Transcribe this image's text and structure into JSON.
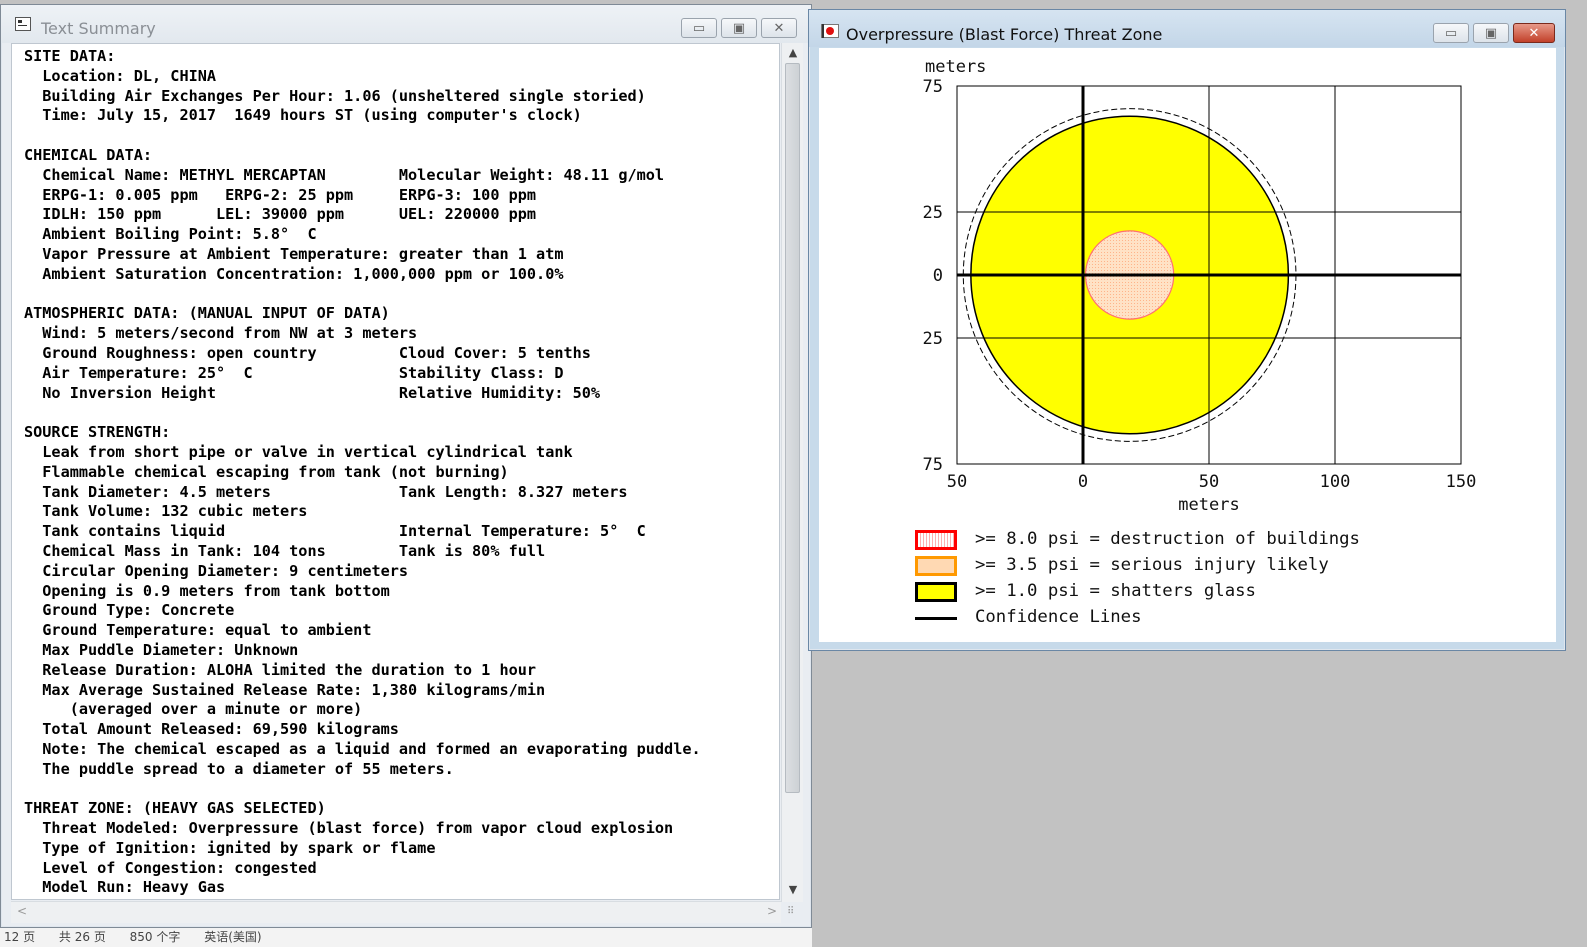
{
  "text_window": {
    "title": "Text Summary",
    "minimize_glyph": "▭",
    "maximize_glyph": "▣",
    "close_glyph": "✕",
    "scroll_up_glyph": "▲",
    "scroll_down_glyph": "▼",
    "scroll_left_glyph": "<",
    "scroll_right_glyph": ">",
    "resize_grip_glyph": "⠿",
    "lines": [
      "SITE DATA:",
      "  Location: DL, CHINA",
      "  Building Air Exchanges Per Hour: 1.06 (unsheltered single storied)",
      "  Time: July 15, 2017  1649 hours ST (using computer's clock)",
      "",
      "CHEMICAL DATA:",
      "  Chemical Name: METHYL MERCAPTAN        Molecular Weight: 48.11 g/mol",
      "  ERPG-1: 0.005 ppm   ERPG-2: 25 ppm     ERPG-3: 100 ppm",
      "  IDLH: 150 ppm      LEL: 39000 ppm      UEL: 220000 ppm",
      "  Ambient Boiling Point: 5.8°  C",
      "  Vapor Pressure at Ambient Temperature: greater than 1 atm",
      "  Ambient Saturation Concentration: 1,000,000 ppm or 100.0%",
      "",
      "ATMOSPHERIC DATA: (MANUAL INPUT OF DATA)",
      "  Wind: 5 meters/second from NW at 3 meters",
      "  Ground Roughness: open country         Cloud Cover: 5 tenths",
      "  Air Temperature: 25°  C                Stability Class: D",
      "  No Inversion Height                    Relative Humidity: 50%",
      "",
      "SOURCE STRENGTH:",
      "  Leak from short pipe or valve in vertical cylindrical tank",
      "  Flammable chemical escaping from tank (not burning)",
      "  Tank Diameter: 4.5 meters              Tank Length: 8.327 meters",
      "  Tank Volume: 132 cubic meters",
      "  Tank contains liquid                   Internal Temperature: 5°  C",
      "  Chemical Mass in Tank: 104 tons        Tank is 80% full",
      "  Circular Opening Diameter: 9 centimeters",
      "  Opening is 0.9 meters from tank bottom",
      "  Ground Type: Concrete",
      "  Ground Temperature: equal to ambient",
      "  Max Puddle Diameter: Unknown",
      "  Release Duration: ALOHA limited the duration to 1 hour",
      "  Max Average Sustained Release Rate: 1,380 kilograms/min",
      "     (averaged over a minute or more)",
      "  Total Amount Released: 69,590 kilograms",
      "  Note: The chemical escaped as a liquid and formed an evaporating puddle.",
      "  The puddle spread to a diameter of 55 meters.",
      "",
      "THREAT ZONE: (HEAVY GAS SELECTED)",
      "  Threat Modeled: Overpressure (blast force) from vapor cloud explosion",
      "  Type of Ignition: ignited by spark or flame",
      "  Level of Congestion: congested",
      "  Model Run: Heavy Gas"
    ]
  },
  "status_bar": {
    "page": "12 页",
    "total": "共 26 页",
    "words": "850 个字",
    "lang": "英语(美国)"
  },
  "plot_window": {
    "title": "Overpressure (Blast Force) Threat Zone",
    "minimize_glyph": "▭",
    "maximize_glyph": "▣",
    "close_glyph": "✕",
    "colors": {
      "destruction": "#ff0000",
      "serious": "#ff9900",
      "shatters": "#ffff00",
      "confidence": "#000000"
    },
    "legend": [
      {
        "label": ">= 8.0 psi = destruction of buildings",
        "swatch": "destruction"
      },
      {
        "label": ">= 3.5 psi = serious injury likely",
        "swatch": "serious"
      },
      {
        "label": ">= 1.0 psi = shatters glass",
        "swatch": "shatters"
      },
      {
        "label": "Confidence Lines",
        "swatch": "confidence"
      }
    ]
  },
  "chart_data": {
    "type": "threat-zone",
    "xlabel": "meters",
    "ylabel": "meters",
    "xlim": [
      -50,
      150
    ],
    "ylim": [
      -75,
      75
    ],
    "x_ticks": [
      {
        "value": -50,
        "label": "50"
      },
      {
        "value": 0,
        "label": "0"
      },
      {
        "value": 50,
        "label": "50"
      },
      {
        "value": 100,
        "label": "100"
      },
      {
        "value": 150,
        "label": "150"
      }
    ],
    "y_ticks": [
      {
        "value": 75,
        "label": "75"
      },
      {
        "value": 25,
        "label": "25"
      },
      {
        "value": 0,
        "label": "0"
      },
      {
        "value": -25,
        "label": "25"
      },
      {
        "value": -75,
        "label": "75"
      }
    ],
    "grid": true,
    "zones": [
      {
        "level": ">= 1.0 psi",
        "center": [
          18.5,
          0
        ],
        "radius": 63,
        "color": "#ffff00",
        "edge": "#000000"
      },
      {
        "level": ">= 3.5 psi",
        "center": [
          18.5,
          0
        ],
        "radius": 17.5,
        "color": "#ffd9b3",
        "edge": "#ff7070"
      },
      {
        "level": ">= 8.0 psi",
        "center": [
          18.5,
          0
        ],
        "radius": 0,
        "color": "#ffd9b3",
        "edge": "#ff0000"
      }
    ],
    "confidence_radius": 66
  }
}
